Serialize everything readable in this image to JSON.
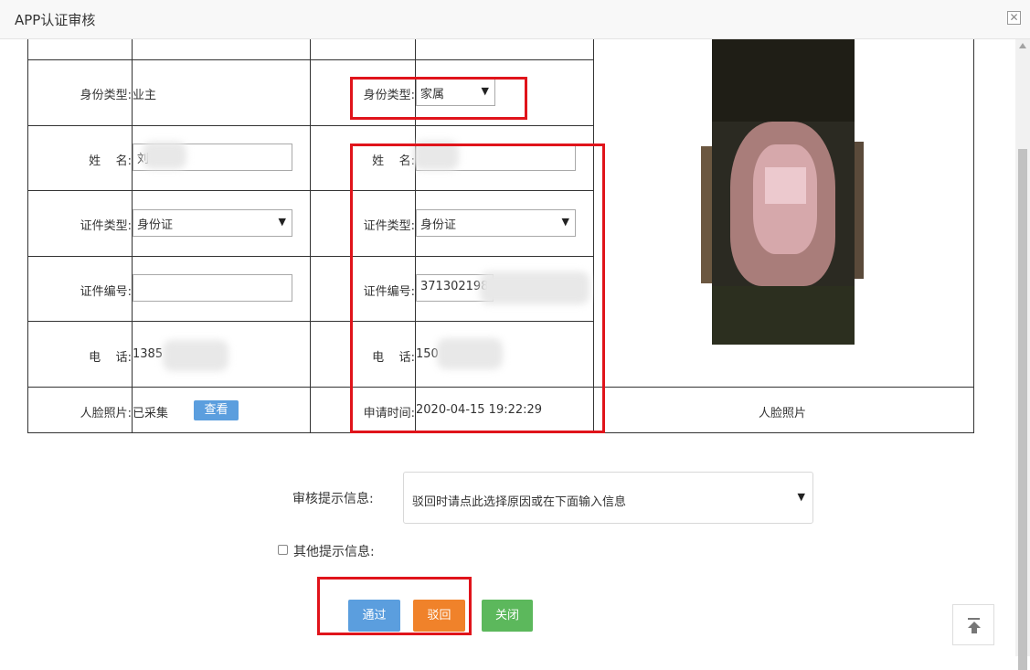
{
  "window": {
    "title": "APP认证审核",
    "close_icon": "close-icon"
  },
  "left": {
    "identity_type_label": "身份类型:",
    "identity_type_value": "业主",
    "name_label": "姓    名:",
    "name_value": "刘",
    "id_type_label": "证件类型:",
    "id_type_value": "身份证",
    "id_number_label": "证件编号:",
    "id_number_value": "",
    "phone_label": "电    话:",
    "phone_value": "1385",
    "face_label": "人脸照片:",
    "face_status": "已采集",
    "view_button": "查看"
  },
  "right": {
    "identity_type_label": "身份类型:",
    "identity_type_value": "家属",
    "name_label": "姓    名:",
    "name_value": "",
    "id_type_label": "证件类型:",
    "id_type_value": "身份证",
    "id_number_label": "证件编号:",
    "id_number_value": "371302198",
    "phone_label": "电    话:",
    "phone_value": "150",
    "apply_time_label": "申请时间:",
    "apply_time_value": "2020-04-15 19:22:29"
  },
  "photo": {
    "caption": "人脸照片"
  },
  "review": {
    "prompt_label": "审核提示信息:",
    "prompt_placeholder": "驳回时请点此选择原因或在下面输入信息",
    "other_label": "其他提示信息:"
  },
  "actions": {
    "pass": "通过",
    "reject": "驳回",
    "close": "关闭"
  },
  "colors": {
    "pass": "#5b9ede",
    "reject": "#f0822a",
    "close": "#5cb85c",
    "highlight": "#e0141b"
  }
}
